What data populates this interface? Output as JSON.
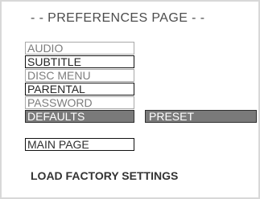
{
  "header": {
    "title": "- - PREFERENCES PAGE - -"
  },
  "menu": {
    "items": [
      {
        "label": "AUDIO"
      },
      {
        "label": "SUBTITLE"
      },
      {
        "label": "DISC MENU"
      },
      {
        "label": "PARENTAL"
      },
      {
        "label": "PASSWORD"
      },
      {
        "label": "DEFAULTS"
      }
    ]
  },
  "submenu": {
    "preset_label": "PRESET"
  },
  "navigation": {
    "main_page_label": "MAIN PAGE"
  },
  "status": {
    "text": "LOAD FACTORY SETTINGS"
  },
  "colors": {
    "selected_background": "#7a7a7a",
    "selected_text": "#ffffff",
    "disabled_text": "#7d7d7d",
    "enabled_text": "#262626"
  }
}
